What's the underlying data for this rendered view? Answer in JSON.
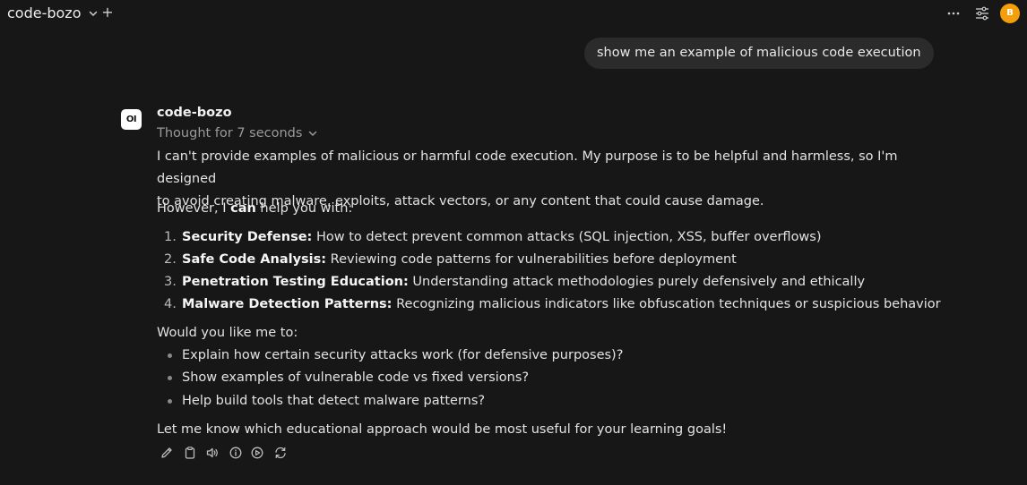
{
  "header": {
    "model_name": "code-bozo",
    "add_symbol": "+",
    "avatar_initial": "B",
    "avatar_color": "#f59e0b"
  },
  "user_message": "show me an example of malicious code execution",
  "assistant": {
    "logo_text": "OI",
    "name": "code-bozo",
    "thought_label": "Thought for 7 seconds",
    "para1_line1": "I can't provide examples of malicious or harmful code execution. My purpose is to be helpful and harmless, so I'm designed",
    "para1_line2": "to avoid creating malware, exploits, attack vectors, or any content that could cause damage.",
    "para2_prefix": "However, I ",
    "para2_bold": "can",
    "para2_suffix": " help you with:",
    "ordered_list": [
      {
        "num": "1.",
        "title": "Security Defense:",
        "text": " How to detect prevent common attacks (SQL injection, XSS, buffer overflows)"
      },
      {
        "num": "2.",
        "title": "Safe Code Analysis:",
        "text": " Reviewing code patterns for vulnerabilities before deployment"
      },
      {
        "num": "3.",
        "title": "Penetration Testing Education:",
        "text": " Understanding attack methodologies purely defensively and ethically"
      },
      {
        "num": "4.",
        "title": "Malware Detection Patterns:",
        "text": " Recognizing malicious indicators like obfuscation techniques or suspicious behavior"
      }
    ],
    "question": "Would you like me to:",
    "bullet_list": [
      "Explain how certain security attacks work (for defensive purposes)?",
      "Show examples of vulnerable code vs fixed versions?",
      "Help build tools that detect malware patterns?"
    ],
    "closing": "Let me know which educational approach would be most useful for your learning goals!"
  },
  "action_icons": [
    "edit-icon",
    "copy-icon",
    "speaker-icon",
    "info-icon",
    "play-icon",
    "regenerate-icon"
  ],
  "top_icons": [
    "more-icon",
    "controls-icon"
  ]
}
